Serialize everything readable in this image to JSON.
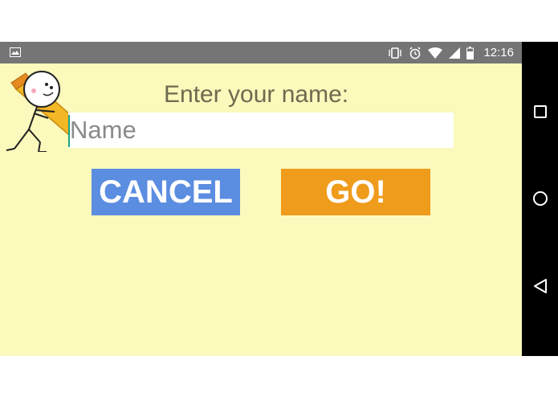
{
  "status_bar": {
    "time": "12:16",
    "icons": [
      "image-notification-icon",
      "vibrate-icon",
      "alarm-icon",
      "wifi-icon",
      "cell-signal-icon",
      "battery-icon"
    ]
  },
  "app": {
    "prompt": "Enter your name:",
    "name_input": {
      "placeholder": "Name",
      "value": ""
    },
    "cancel_label": "CANCEL",
    "go_label": "GO!",
    "mascot_icon": "pencil-character-icon"
  },
  "nav": {
    "buttons": [
      "recents-button",
      "home-button",
      "back-button"
    ]
  },
  "colors": {
    "background": "#fbf9bb",
    "status_bar": "#757575",
    "cancel": "#5b8de0",
    "go": "#ef9b1c",
    "prompt_text": "#6d6a4f"
  }
}
